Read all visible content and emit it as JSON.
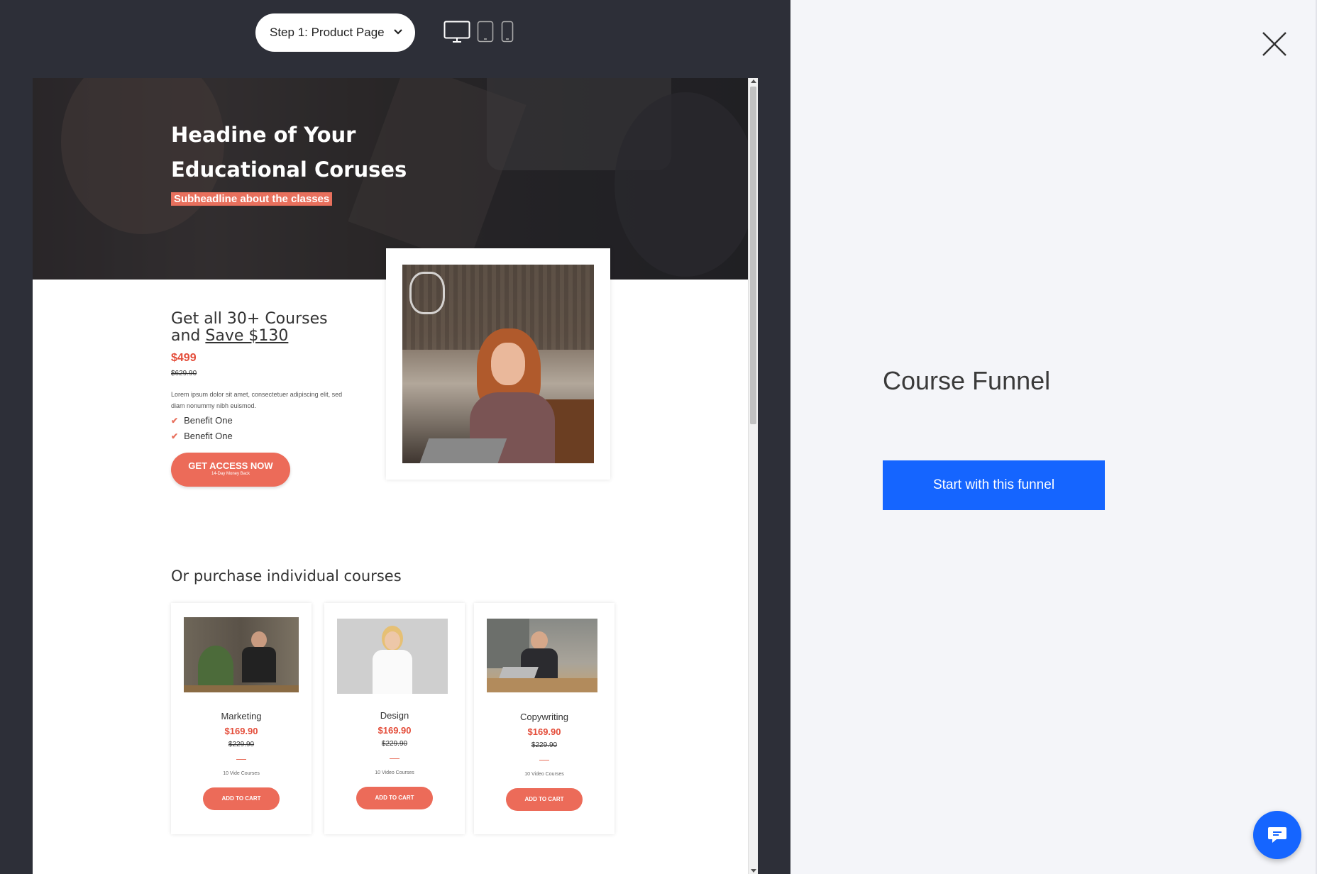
{
  "toolbar": {
    "step_select": "Step 1: Product Page",
    "devices": [
      "desktop-icon",
      "tablet-icon",
      "mobile-icon"
    ]
  },
  "preview": {
    "hero": {
      "title": "Headine of Your Educational Coruses",
      "subheadline": "Subheadline about the classes"
    },
    "offer": {
      "title_prefix": "Get all 30+ Courses and ",
      "title_link": "Save $130",
      "price": "$499",
      "old_price": "$629.90",
      "description": "Lorem ipsum dolor sit amet, consectetuer adipiscing elit, sed diam nonummy nibh euismod.",
      "benefits": [
        "Benefit One",
        "Benefit One"
      ],
      "cta_label": "GET ACCESS NOW",
      "cta_sub": "14-Day Money Back"
    },
    "individual_title": "Or purchase individual courses",
    "courses": [
      {
        "name": "Marketing",
        "price": "$169.90",
        "old_price": "$229.90",
        "count": "10 Vide Courses",
        "button": "ADD TO CART"
      },
      {
        "name": "Design",
        "price": "$169.90",
        "old_price": "$229.90",
        "count": "10 Video Courses",
        "button": "ADD TO CART"
      },
      {
        "name": "Copywriting",
        "price": "$169.90",
        "old_price": "$229.90",
        "count": "10 Video Courses",
        "button": "ADD TO CART"
      }
    ]
  },
  "panel": {
    "title": "Course Funnel",
    "start_button": "Start with this funnel",
    "close_icon": "close-icon",
    "chat_icon": "chat-icon"
  },
  "colors": {
    "accent": "#1565ff",
    "coral": "#ec6b59",
    "price_red": "#e44d3a",
    "dark_bg": "#2d2f38",
    "panel_bg": "#f4f5f9"
  }
}
